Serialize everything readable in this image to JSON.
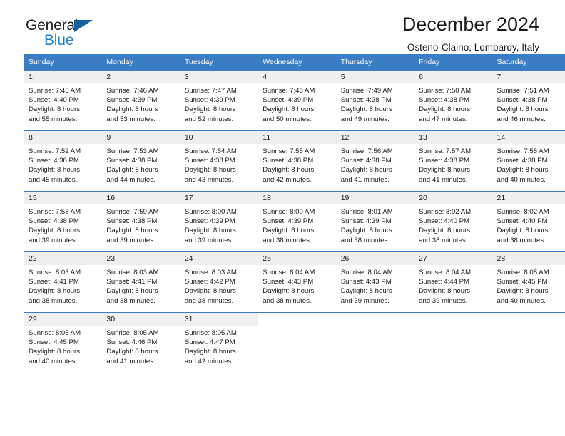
{
  "brand": {
    "name_top": "General",
    "name_bottom": "Blue",
    "flag_icon": "triangle-flag-icon",
    "color_dark": "#231f20",
    "color_blue": "#1b7fd4"
  },
  "header": {
    "title": "December 2024",
    "location": "Osteno-Claino, Lombardy, Italy"
  },
  "calendar": {
    "accent_color": "#3b7dc4",
    "band_color": "#efefef",
    "weekdays": [
      "Sunday",
      "Monday",
      "Tuesday",
      "Wednesday",
      "Thursday",
      "Friday",
      "Saturday"
    ],
    "weeks": [
      [
        {
          "day": "1",
          "sunrise": "Sunrise: 7:45 AM",
          "sunset": "Sunset: 4:40 PM",
          "daylight1": "Daylight: 8 hours",
          "daylight2": "and 55 minutes."
        },
        {
          "day": "2",
          "sunrise": "Sunrise: 7:46 AM",
          "sunset": "Sunset: 4:39 PM",
          "daylight1": "Daylight: 8 hours",
          "daylight2": "and 53 minutes."
        },
        {
          "day": "3",
          "sunrise": "Sunrise: 7:47 AM",
          "sunset": "Sunset: 4:39 PM",
          "daylight1": "Daylight: 8 hours",
          "daylight2": "and 52 minutes."
        },
        {
          "day": "4",
          "sunrise": "Sunrise: 7:48 AM",
          "sunset": "Sunset: 4:39 PM",
          "daylight1": "Daylight: 8 hours",
          "daylight2": "and 50 minutes."
        },
        {
          "day": "5",
          "sunrise": "Sunrise: 7:49 AM",
          "sunset": "Sunset: 4:38 PM",
          "daylight1": "Daylight: 8 hours",
          "daylight2": "and 49 minutes."
        },
        {
          "day": "6",
          "sunrise": "Sunrise: 7:50 AM",
          "sunset": "Sunset: 4:38 PM",
          "daylight1": "Daylight: 8 hours",
          "daylight2": "and 47 minutes."
        },
        {
          "day": "7",
          "sunrise": "Sunrise: 7:51 AM",
          "sunset": "Sunset: 4:38 PM",
          "daylight1": "Daylight: 8 hours",
          "daylight2": "and 46 minutes."
        }
      ],
      [
        {
          "day": "8",
          "sunrise": "Sunrise: 7:52 AM",
          "sunset": "Sunset: 4:38 PM",
          "daylight1": "Daylight: 8 hours",
          "daylight2": "and 45 minutes."
        },
        {
          "day": "9",
          "sunrise": "Sunrise: 7:53 AM",
          "sunset": "Sunset: 4:38 PM",
          "daylight1": "Daylight: 8 hours",
          "daylight2": "and 44 minutes."
        },
        {
          "day": "10",
          "sunrise": "Sunrise: 7:54 AM",
          "sunset": "Sunset: 4:38 PM",
          "daylight1": "Daylight: 8 hours",
          "daylight2": "and 43 minutes."
        },
        {
          "day": "11",
          "sunrise": "Sunrise: 7:55 AM",
          "sunset": "Sunset: 4:38 PM",
          "daylight1": "Daylight: 8 hours",
          "daylight2": "and 42 minutes."
        },
        {
          "day": "12",
          "sunrise": "Sunrise: 7:56 AM",
          "sunset": "Sunset: 4:38 PM",
          "daylight1": "Daylight: 8 hours",
          "daylight2": "and 41 minutes."
        },
        {
          "day": "13",
          "sunrise": "Sunrise: 7:57 AM",
          "sunset": "Sunset: 4:38 PM",
          "daylight1": "Daylight: 8 hours",
          "daylight2": "and 41 minutes."
        },
        {
          "day": "14",
          "sunrise": "Sunrise: 7:58 AM",
          "sunset": "Sunset: 4:38 PM",
          "daylight1": "Daylight: 8 hours",
          "daylight2": "and 40 minutes."
        }
      ],
      [
        {
          "day": "15",
          "sunrise": "Sunrise: 7:58 AM",
          "sunset": "Sunset: 4:38 PM",
          "daylight1": "Daylight: 8 hours",
          "daylight2": "and 39 minutes."
        },
        {
          "day": "16",
          "sunrise": "Sunrise: 7:59 AM",
          "sunset": "Sunset: 4:38 PM",
          "daylight1": "Daylight: 8 hours",
          "daylight2": "and 39 minutes."
        },
        {
          "day": "17",
          "sunrise": "Sunrise: 8:00 AM",
          "sunset": "Sunset: 4:39 PM",
          "daylight1": "Daylight: 8 hours",
          "daylight2": "and 39 minutes."
        },
        {
          "day": "18",
          "sunrise": "Sunrise: 8:00 AM",
          "sunset": "Sunset: 4:39 PM",
          "daylight1": "Daylight: 8 hours",
          "daylight2": "and 38 minutes."
        },
        {
          "day": "19",
          "sunrise": "Sunrise: 8:01 AM",
          "sunset": "Sunset: 4:39 PM",
          "daylight1": "Daylight: 8 hours",
          "daylight2": "and 38 minutes."
        },
        {
          "day": "20",
          "sunrise": "Sunrise: 8:02 AM",
          "sunset": "Sunset: 4:40 PM",
          "daylight1": "Daylight: 8 hours",
          "daylight2": "and 38 minutes."
        },
        {
          "day": "21",
          "sunrise": "Sunrise: 8:02 AM",
          "sunset": "Sunset: 4:40 PM",
          "daylight1": "Daylight: 8 hours",
          "daylight2": "and 38 minutes."
        }
      ],
      [
        {
          "day": "22",
          "sunrise": "Sunrise: 8:03 AM",
          "sunset": "Sunset: 4:41 PM",
          "daylight1": "Daylight: 8 hours",
          "daylight2": "and 38 minutes."
        },
        {
          "day": "23",
          "sunrise": "Sunrise: 8:03 AM",
          "sunset": "Sunset: 4:41 PM",
          "daylight1": "Daylight: 8 hours",
          "daylight2": "and 38 minutes."
        },
        {
          "day": "24",
          "sunrise": "Sunrise: 8:03 AM",
          "sunset": "Sunset: 4:42 PM",
          "daylight1": "Daylight: 8 hours",
          "daylight2": "and 38 minutes."
        },
        {
          "day": "25",
          "sunrise": "Sunrise: 8:04 AM",
          "sunset": "Sunset: 4:43 PM",
          "daylight1": "Daylight: 8 hours",
          "daylight2": "and 38 minutes."
        },
        {
          "day": "26",
          "sunrise": "Sunrise: 8:04 AM",
          "sunset": "Sunset: 4:43 PM",
          "daylight1": "Daylight: 8 hours",
          "daylight2": "and 39 minutes."
        },
        {
          "day": "27",
          "sunrise": "Sunrise: 8:04 AM",
          "sunset": "Sunset: 4:44 PM",
          "daylight1": "Daylight: 8 hours",
          "daylight2": "and 39 minutes."
        },
        {
          "day": "28",
          "sunrise": "Sunrise: 8:05 AM",
          "sunset": "Sunset: 4:45 PM",
          "daylight1": "Daylight: 8 hours",
          "daylight2": "and 40 minutes."
        }
      ],
      [
        {
          "day": "29",
          "sunrise": "Sunrise: 8:05 AM",
          "sunset": "Sunset: 4:45 PM",
          "daylight1": "Daylight: 8 hours",
          "daylight2": "and 40 minutes."
        },
        {
          "day": "30",
          "sunrise": "Sunrise: 8:05 AM",
          "sunset": "Sunset: 4:46 PM",
          "daylight1": "Daylight: 8 hours",
          "daylight2": "and 41 minutes."
        },
        {
          "day": "31",
          "sunrise": "Sunrise: 8:05 AM",
          "sunset": "Sunset: 4:47 PM",
          "daylight1": "Daylight: 8 hours",
          "daylight2": "and 42 minutes."
        },
        {
          "day": "",
          "sunrise": "",
          "sunset": "",
          "daylight1": "",
          "daylight2": ""
        },
        {
          "day": "",
          "sunrise": "",
          "sunset": "",
          "daylight1": "",
          "daylight2": ""
        },
        {
          "day": "",
          "sunrise": "",
          "sunset": "",
          "daylight1": "",
          "daylight2": ""
        },
        {
          "day": "",
          "sunrise": "",
          "sunset": "",
          "daylight1": "",
          "daylight2": ""
        }
      ]
    ]
  }
}
